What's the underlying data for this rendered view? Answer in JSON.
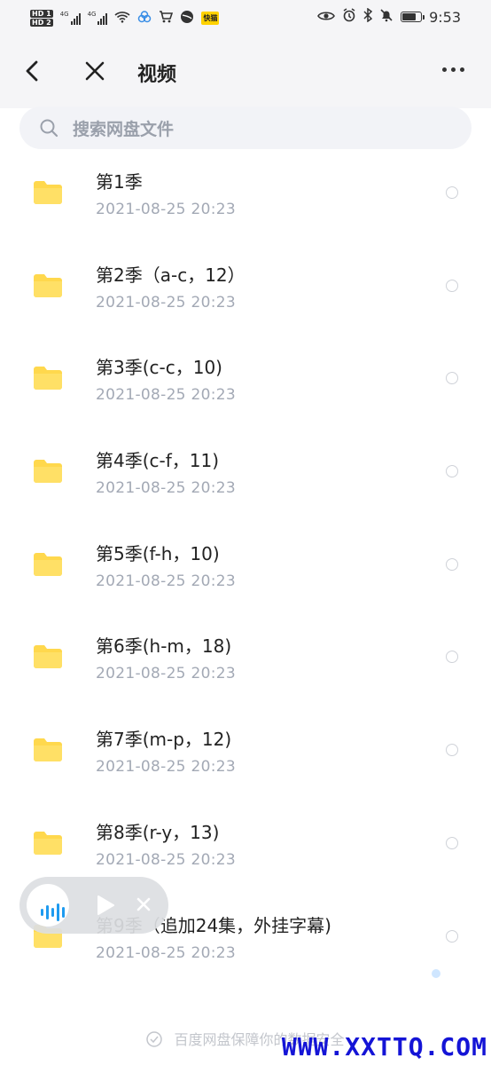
{
  "status_bar": {
    "network_badges": [
      "HD 1",
      "HD 2"
    ],
    "signal_labels": [
      "4G",
      "4G"
    ],
    "app_badge": "快猫",
    "time": "9:53",
    "battery_level_pct": 75
  },
  "header": {
    "title": "视频"
  },
  "search": {
    "placeholder": "搜索网盘文件"
  },
  "files": [
    {
      "name": "第1季",
      "date": "2021-08-25  20:23"
    },
    {
      "name": "第2季（a-c，12）",
      "date": "2021-08-25  20:23"
    },
    {
      "name": "第3季(c-c，10)",
      "date": "2021-08-25  20:23"
    },
    {
      "name": "第4季(c-f，11)",
      "date": "2021-08-25  20:23"
    },
    {
      "name": "第5季(f-h，10)",
      "date": "2021-08-25  20:23"
    },
    {
      "name": "第6季(h-m，18)",
      "date": "2021-08-25  20:23"
    },
    {
      "name": "第7季(m-p，12)",
      "date": "2021-08-25  20:23"
    },
    {
      "name": "第8季(r-y，13)",
      "date": "2021-08-25  20:23"
    },
    {
      "name": "第9季（追加24集，外挂字幕)",
      "date": "2021-08-25  20:23"
    }
  ],
  "footer": {
    "text": "百度网盘保障你的数据安全"
  },
  "watermark": {
    "text": "WWW.XXTTQ.COM"
  },
  "colors": {
    "folder": "#ffd84d",
    "accent": "#1e9bf0",
    "watermark": "#1414d6"
  }
}
